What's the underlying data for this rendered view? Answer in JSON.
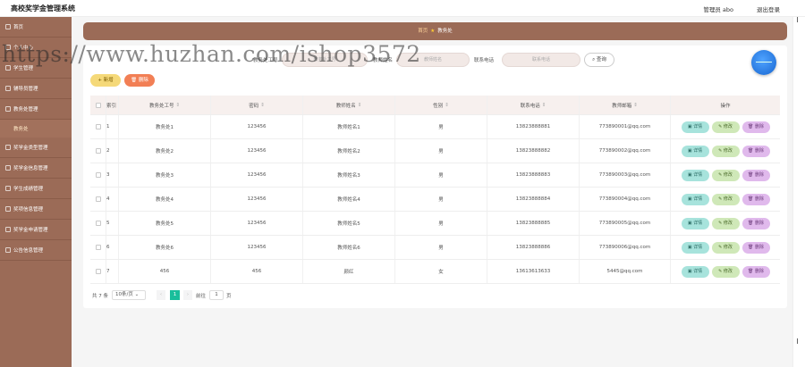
{
  "header": {
    "app_title": "高校奖学金管理系统",
    "admin_label": "管理员 abo",
    "logout_label": "退出登录"
  },
  "sidebar": {
    "items": [
      {
        "label": "首页"
      },
      {
        "label": "个人中心"
      },
      {
        "label": "学生管理"
      },
      {
        "label": "辅导员管理"
      },
      {
        "label": "教务处管理"
      },
      {
        "label": "奖学金类型管理"
      },
      {
        "label": "奖学金信息管理"
      },
      {
        "label": "学生成绩管理"
      },
      {
        "label": "奖项信息管理"
      },
      {
        "label": "奖学金申请管理"
      },
      {
        "label": "公告信息管理"
      }
    ],
    "sub_item": "教务处"
  },
  "breadcrumb": {
    "home": "首页",
    "current": "教务处"
  },
  "search": {
    "field1_label": "教务处工号",
    "field1_placeholder": "教务处工号",
    "field2_label": "教师姓名",
    "field2_placeholder": "教师姓名",
    "field3_label": "联系电话",
    "field3_placeholder": "联系电话",
    "query_label": "查询"
  },
  "toolbar": {
    "add_label": "+ 新增",
    "delete_label": "删除"
  },
  "table": {
    "headers": {
      "index": "索引",
      "id": "教务处工号",
      "password": "密码",
      "name": "教师姓名",
      "gender": "性别",
      "phone": "联系电话",
      "email": "教师邮箱",
      "actions": "操作"
    },
    "rows": [
      {
        "index": "1",
        "id": "教务处1",
        "password": "123456",
        "name": "教师姓名1",
        "gender": "男",
        "phone": "13823888881",
        "email": "773890001@qq.com"
      },
      {
        "index": "2",
        "id": "教务处2",
        "password": "123456",
        "name": "教师姓名2",
        "gender": "男",
        "phone": "13823888882",
        "email": "773890002@qq.com"
      },
      {
        "index": "3",
        "id": "教务处3",
        "password": "123456",
        "name": "教师姓名3",
        "gender": "男",
        "phone": "13823888883",
        "email": "773890003@qq.com"
      },
      {
        "index": "4",
        "id": "教务处4",
        "password": "123456",
        "name": "教师姓名4",
        "gender": "男",
        "phone": "13823888884",
        "email": "773890004@qq.com"
      },
      {
        "index": "5",
        "id": "教务处5",
        "password": "123456",
        "name": "教师姓名5",
        "gender": "男",
        "phone": "13823888885",
        "email": "773890005@qq.com"
      },
      {
        "index": "6",
        "id": "教务处6",
        "password": "123456",
        "name": "教师姓名6",
        "gender": "男",
        "phone": "13823888886",
        "email": "773890006@qq.com"
      },
      {
        "index": "7",
        "id": "456",
        "password": "456",
        "name": "颜红",
        "gender": "女",
        "phone": "13613613633",
        "email": "5445@qq.com"
      }
    ],
    "action_labels": {
      "detail": "详情",
      "edit": "修改",
      "remove": "删除"
    }
  },
  "pagination": {
    "total": "共 7 条",
    "page_size": "10条/页",
    "current_page": "1",
    "goto_label": "前往",
    "goto_value": "1",
    "page_unit": "页"
  },
  "watermark": "https://www.huzhan.com/ishop3572",
  "colors": {
    "sidebar": "#9b6b57",
    "breadcrumb": "#9b6b57",
    "add_button": "#f5d979",
    "delete_button": "#f27f55",
    "detail_button": "#a7e3dc",
    "edit_button": "#cfe8b8",
    "remove_button": "#e0b9ec",
    "pager_active": "#19be9b"
  }
}
